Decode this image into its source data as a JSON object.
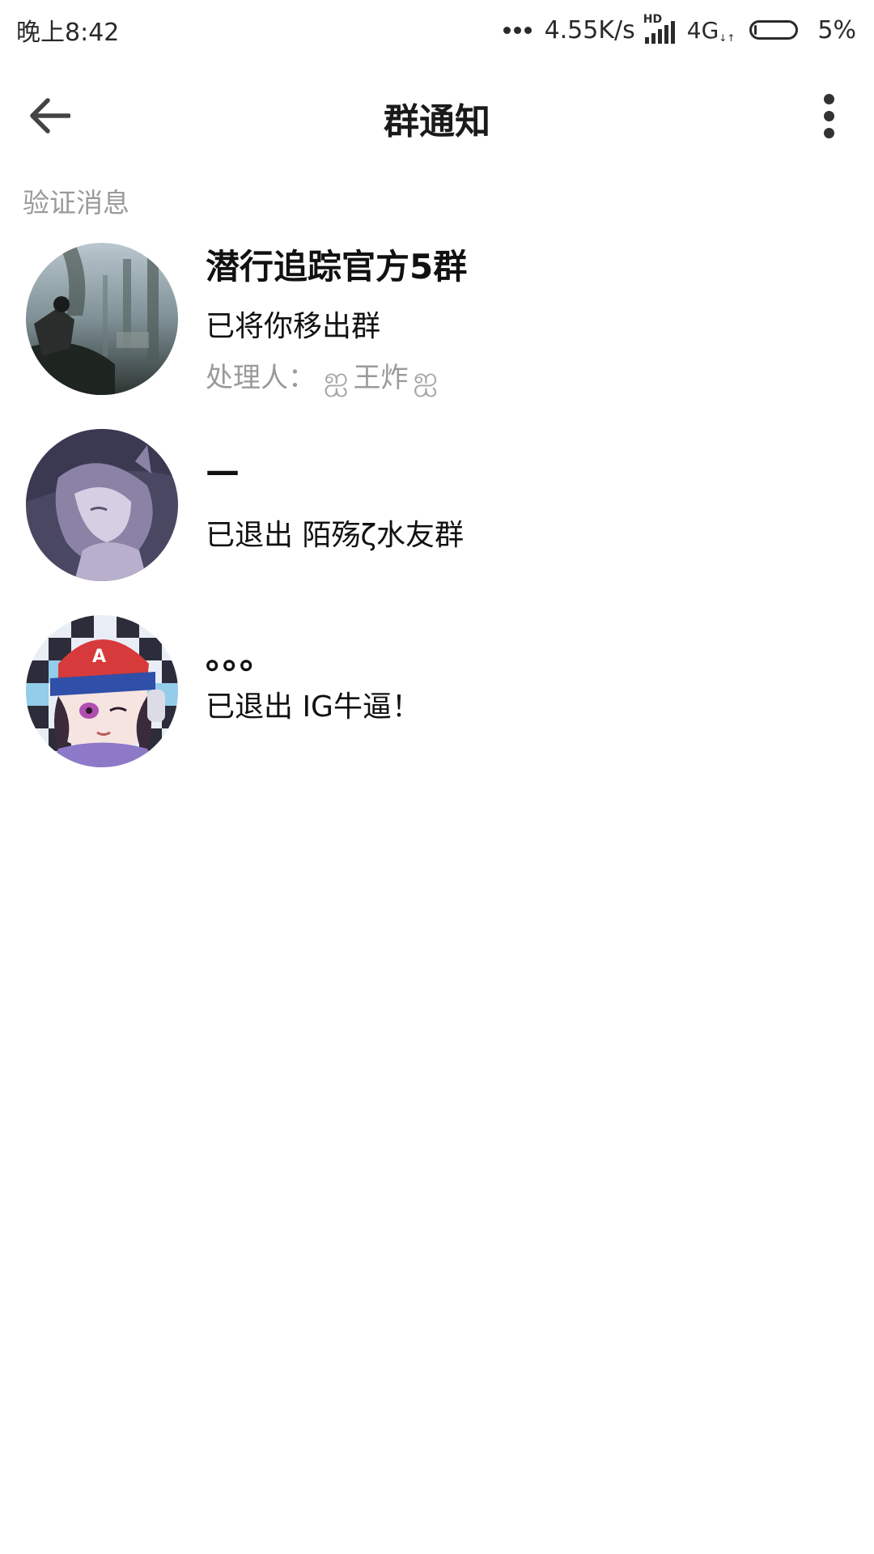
{
  "status_bar": {
    "time": "晚上8:42",
    "network_speed": "4.55K/s",
    "hd_label": "HD",
    "network_type": "4G",
    "battery_percent": "5%"
  },
  "header": {
    "title": "群通知",
    "back_icon": "arrow-left-icon",
    "more_icon": "more-vertical-icon"
  },
  "section": {
    "label": "验证消息"
  },
  "notices": [
    {
      "name": "潜行追踪官方5群",
      "message": "已将你移出群",
      "handler_label": "处理人：",
      "handler_name": "王炸",
      "handler_left_decoration": "ஐ",
      "handler_right_decoration": "ஐ",
      "avatar_icon": "forest-soldier-avatar"
    },
    {
      "name": "—",
      "message": "已退出 陌殇ζ水友群",
      "avatar_icon": "sleeping-anime-girl-avatar"
    },
    {
      "name": "。。。",
      "message": "已退出 IG牛逼！",
      "avatar_icon": "anime-boy-red-cap-avatar"
    }
  ],
  "colors": {
    "background": "#ffffff",
    "primary_text": "#111111",
    "secondary_text": "#9a9a9a"
  }
}
